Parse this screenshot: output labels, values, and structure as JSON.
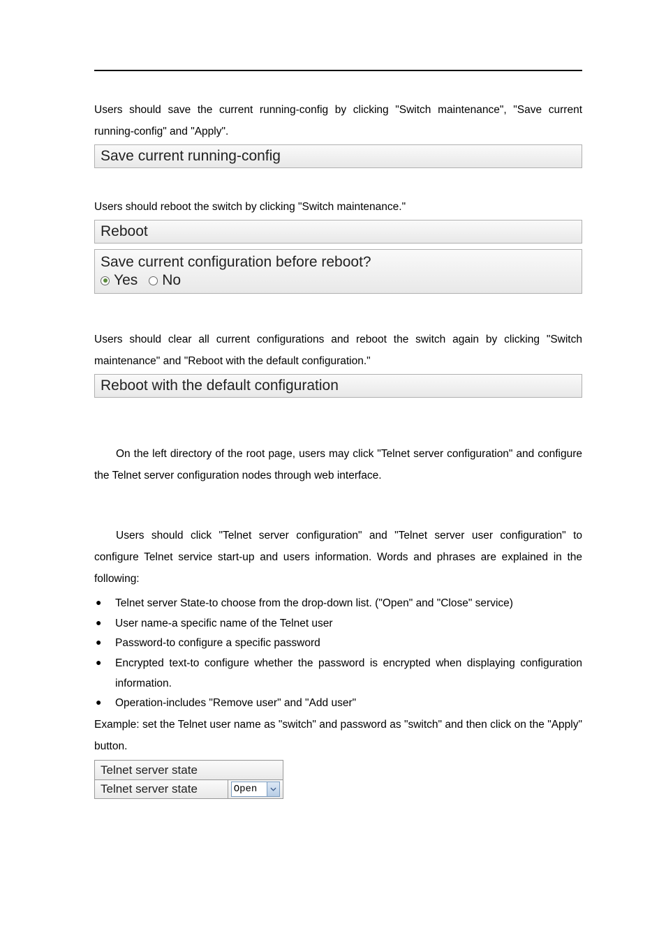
{
  "para1": "Users should save the current running-config by clicking \"Switch maintenance\", \"Save current running-config\" and \"Apply\".",
  "panel1": "Save current running-config",
  "para2": "Users should reboot the switch by clicking \"Switch maintenance.\"",
  "panel2": "Reboot",
  "rebootQuestion": "Save current configuration before reboot?",
  "yes": "Yes",
  "no": "No",
  "para3": "Users should clear all current configurations and reboot the switch again by clicking \"Switch maintenance\" and \"Reboot with the default configuration.\"",
  "panel3": "Reboot with the default configuration",
  "para4": "On the left directory of the root page, users may click \"Telnet server configuration\" and configure the Telnet server configuration nodes through web interface.",
  "para5": "Users should click \"Telnet server configuration\" and \"Telnet server user configuration\" to configure Telnet service start-up and users information. Words and phrases are explained in the following:",
  "bullets": [
    "Telnet server State-to choose from the drop-down list. (\"Open\" and \"Close\" service)",
    "User name-a specific name of the Telnet user",
    "Password-to configure a specific password",
    "Encrypted text-to configure whether the password is encrypted when displaying configuration information.",
    "Operation-includes \"Remove user\" and \"Add user\""
  ],
  "para6": "Example: set the Telnet user name as \"switch\" and password as \"switch\" and then click on the \"Apply\" button.",
  "telnetHeader": "Telnet server state",
  "telnetLabel": "Telnet server state",
  "telnetValue": "Open"
}
